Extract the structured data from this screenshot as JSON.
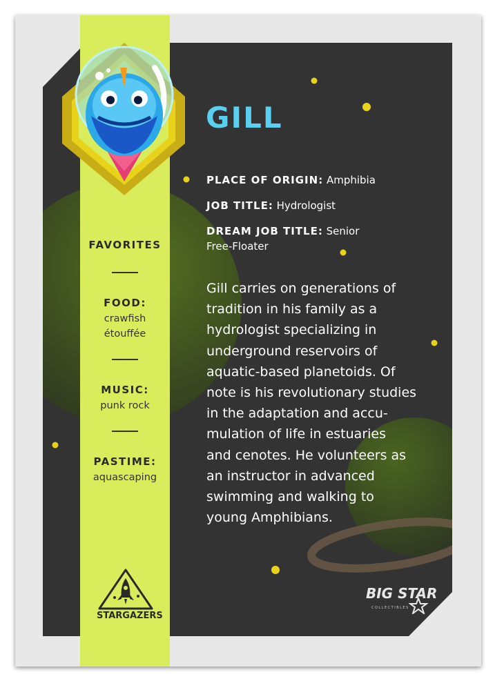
{
  "character": {
    "name": "GILL",
    "origin_label": "PLACE OF ORIGIN:",
    "origin_value": "Amphibia",
    "job_label": "JOB TITLE:",
    "job_value": "Hydrologist",
    "dream_label": "DREAM JOB TITLE:",
    "dream_value_1": "Senior",
    "dream_value_2": "Free-Floater",
    "bio_lines": [
      "Gill carries on generations of",
      "tradition in his family as a",
      "hydrologist specializing in",
      "underground reservoirs of",
      "aquatic-based planetoids. Of",
      "note is his revolutionary studies",
      "in the adaptation and accu-",
      "mulation of life in estuaries",
      "and cenotes. He volunteers as",
      "an instructor in advanced",
      "swimming and walking to",
      "young Amphibians."
    ]
  },
  "favorites": {
    "heading": "FAVORITES",
    "food_label": "FOOD:",
    "food_value_1": "crawfish",
    "food_value_2": "étouffée",
    "music_label": "MUSIC:",
    "music_value": "punk rock",
    "pastime_label": "PASTIME:",
    "pastime_value": "aquascaping"
  },
  "badge": {
    "text": "STARGAZERS"
  },
  "brand": {
    "name": "BIG STAR",
    "sub": "COLLECTIBLES"
  },
  "colors": {
    "panel": "#333333",
    "stripe": "#d9ec5c",
    "name": "#5ad0f0",
    "star_dot": "#e8d21a",
    "card": "#e8e8e8"
  },
  "icons": [
    "fish-astronaut-avatar",
    "stargazers-rocket-badge-icon",
    "big-star-logo-icon"
  ]
}
